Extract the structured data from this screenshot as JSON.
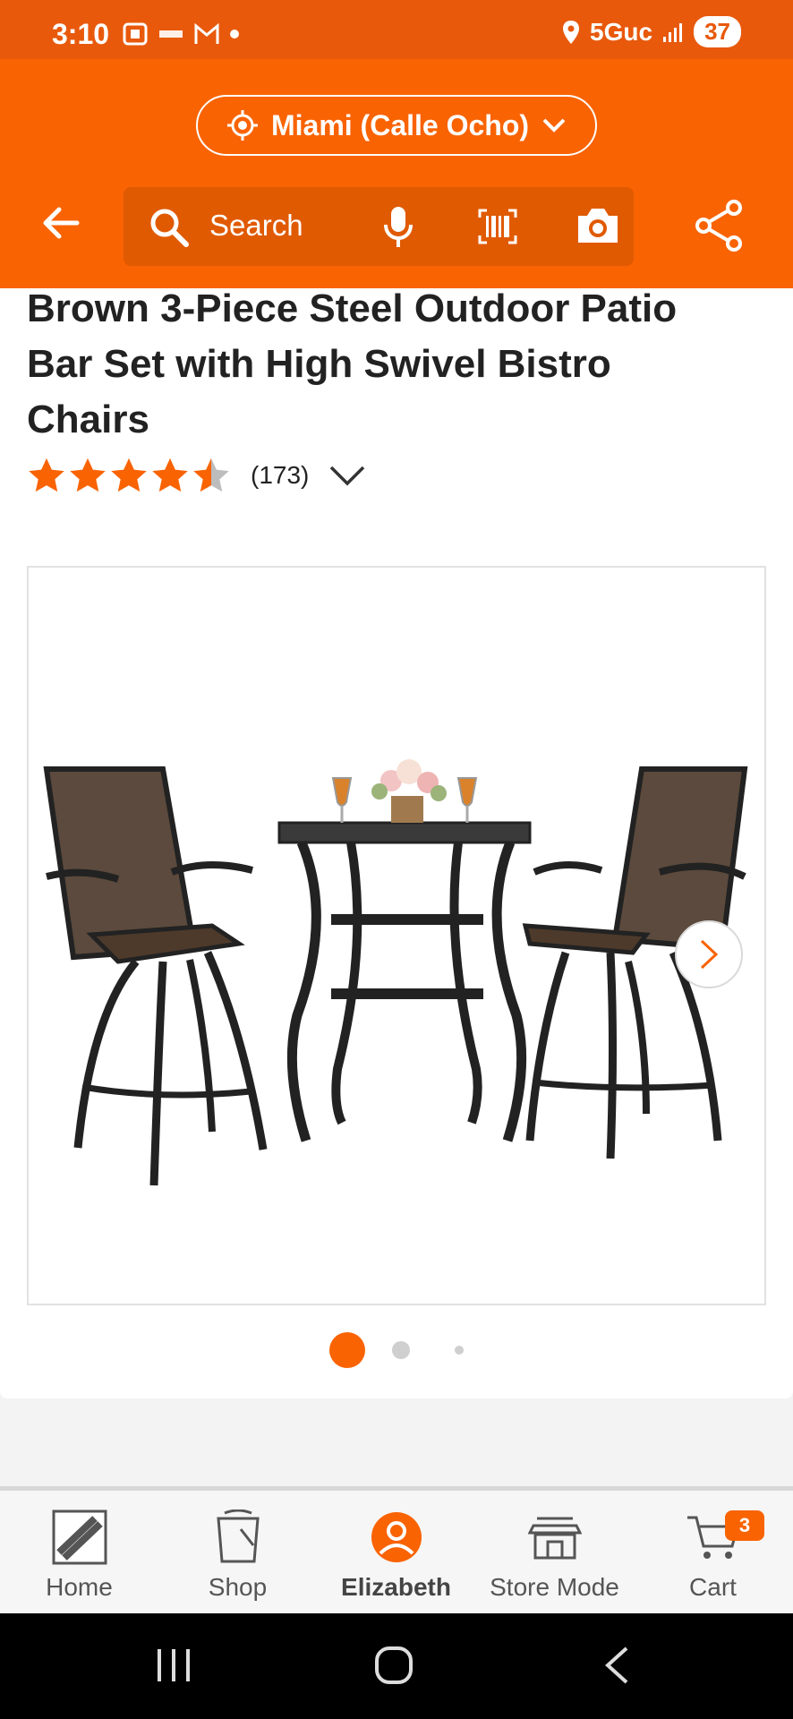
{
  "status_bar": {
    "time": "3:10",
    "network": "5Guc",
    "battery": "37"
  },
  "header": {
    "location": "Miami (Calle Ocho)",
    "search_placeholder": "Search"
  },
  "product": {
    "title": "Brown 3-Piece Steel Outdoor Patio Bar Set with High Swivel Bistro Chairs",
    "rating": 4.5,
    "review_count": "(173)"
  },
  "carousel": {
    "total_dots": 3,
    "active_index": 0
  },
  "bottom_nav": {
    "items": [
      {
        "label": "Home"
      },
      {
        "label": "Shop"
      },
      {
        "label": "Elizabeth"
      },
      {
        "label": "Store Mode"
      },
      {
        "label": "Cart"
      }
    ],
    "cart_count": "3"
  },
  "colors": {
    "brand": "#f96302",
    "status_bar": "#e8590c"
  }
}
